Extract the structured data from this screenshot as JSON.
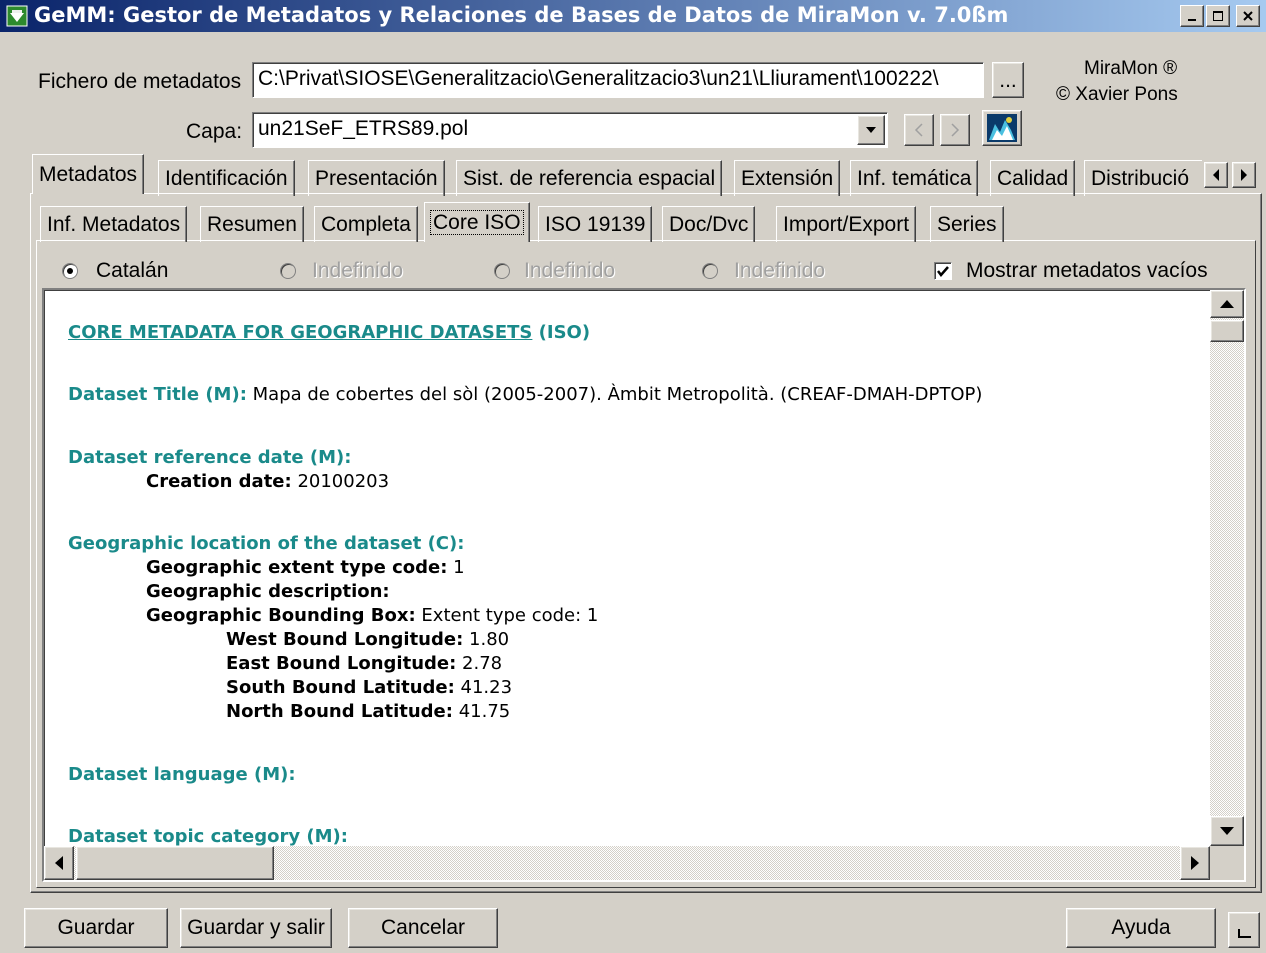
{
  "window": {
    "title": "GeMM: Gestor de Metadatos y Relaciones de Bases de Datos de MiraMon v. 7.0ßm"
  },
  "header": {
    "metadata_file_label": "Fichero de metadatos",
    "metadata_file_value": "C:\\Privat\\SIOSE\\Generalitzacio\\Generalitzacio3\\un21\\Lliurament\\100222\\",
    "browse_label": "...",
    "brand_line1": "MiraMon ®",
    "brand_line2": "© Xavier Pons",
    "layer_label": "Capa:",
    "layer_value": "un21SeF_ETRS89.pol"
  },
  "main_tabs": [
    "Metadatos",
    "Identificación",
    "Presentación",
    "Sist. de referencia espacial",
    "Extensión",
    "Inf. temática",
    "Calidad",
    "Distribució"
  ],
  "sub_tabs": [
    "Inf. Metadatos",
    "Resumen",
    "Completa",
    "Core ISO",
    "ISO 19139",
    "Doc/Dvc",
    "Import/Export",
    "Series"
  ],
  "languages": {
    "selected": "Catalán",
    "option2": "Indefinido",
    "option3": "Indefinido",
    "option4": "Indefinido"
  },
  "show_empty_label": "Mostrar metadatos vacíos",
  "doc": {
    "heading_link": "CORE METADATA FOR GEOGRAPHIC DATASETS",
    "heading_suffix": " (ISO)",
    "title_label": "Dataset Title (M):",
    "title_value": " Mapa de cobertes del sòl (2005-2007). Àmbit Metropolità. (CREAF-DMAH-DPTOP)",
    "refdate_label": "Dataset reference date (M):",
    "creation_label": "Creation date:",
    "creation_value": " 20100203",
    "geoloc_label": "Geographic location of the dataset (C):",
    "extent_type_label": "Geographic extent type code:",
    "extent_type_value": " 1",
    "geo_desc_label": "Geographic description:",
    "bbox_label": "Geographic Bounding Box:",
    "bbox_value": " Extent type code: 1",
    "west_label": "West Bound Longitude:",
    "west_value": " 1.80",
    "east_label": "East Bound Longitude:",
    "east_value": " 2.78",
    "south_label": "South Bound Latitude:",
    "south_value": " 41.23",
    "north_label": "North Bound Latitude:",
    "north_value": " 41.75",
    "language_label": "Dataset language (M):",
    "topic_label": "Dataset topic category (M):"
  },
  "buttons": {
    "save": "Guardar",
    "save_exit": "Guardar y salir",
    "cancel": "Cancelar",
    "help": "Ayuda"
  },
  "colors": {
    "teal": "#1a8a8a",
    "titlebar": "#0a246a",
    "face": "#d4d0c8"
  }
}
